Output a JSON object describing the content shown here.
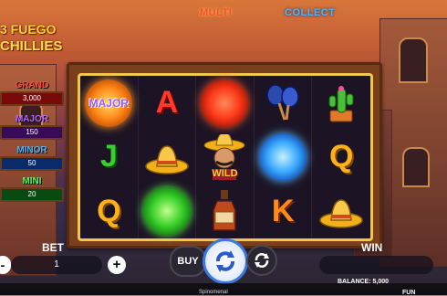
{
  "game": {
    "title_top": "3 FUEGO",
    "title_bottom": "CHILLIES",
    "banner_left": "MULTI",
    "banner_right": "COLLECT"
  },
  "jackpots": [
    {
      "name": "GRAND",
      "value": "3,000",
      "color": "#ff4a3a",
      "bar": "#7a0a0a"
    },
    {
      "name": "MAJOR",
      "value": "150",
      "color": "#c060ff",
      "bar": "#3a0a5a"
    },
    {
      "name": "MINOR",
      "value": "50",
      "color": "#49b6ff",
      "bar": "#0a2a6a"
    },
    {
      "name": "MINI",
      "value": "20",
      "color": "#4aff5a",
      "bar": "#0a4a10"
    }
  ],
  "reels": {
    "symbols": [
      {
        "type": "orb",
        "color": "orange",
        "label": "MAJOR"
      },
      {
        "type": "letter",
        "text": "A",
        "color": "#ff3a2a"
      },
      {
        "type": "orb",
        "color": "red",
        "label": ""
      },
      {
        "type": "icon",
        "icon": "maracas-icon"
      },
      {
        "type": "icon",
        "icon": "cactus-icon"
      },
      {
        "type": "letter",
        "text": "J",
        "color": "#3ad02a"
      },
      {
        "type": "icon",
        "icon": "sombrero-icon"
      },
      {
        "type": "wild",
        "icon": "mariachi-icon",
        "label": "WILD"
      },
      {
        "type": "orb",
        "color": "blue",
        "label": ""
      },
      {
        "type": "letter",
        "text": "Q",
        "color": "#ffb01a"
      },
      {
        "type": "letter",
        "text": "Q",
        "color": "#ffb01a"
      },
      {
        "type": "orb",
        "color": "green",
        "label": ""
      },
      {
        "type": "icon",
        "icon": "tequila-bottle-icon"
      },
      {
        "type": "letter",
        "text": "K",
        "color": "#ff8a1a"
      },
      {
        "type": "icon",
        "icon": "sombrero-icon"
      }
    ]
  },
  "controls": {
    "bet_label": "BET",
    "bet_value": "1",
    "minus": "-",
    "plus": "+",
    "buy_label": "BUY",
    "win_label": "WIN",
    "balance": "BALANCE: 5,000",
    "mode": "FUN",
    "brand": "Spinomenal"
  }
}
